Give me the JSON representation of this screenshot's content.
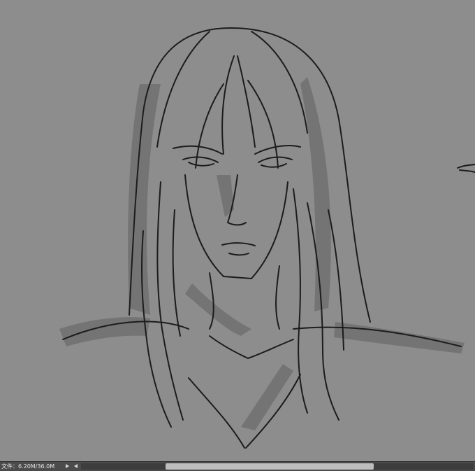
{
  "canvas": {
    "background_color": "#8d8d8d",
    "content": "sketch-artwork"
  },
  "statusbar": {
    "doc_info": "文件：6.20M/36.0M",
    "menu_icon": "triangle-right-icon",
    "scroll_left_icon": "triangle-left-icon",
    "scroll_position": 0.46
  }
}
